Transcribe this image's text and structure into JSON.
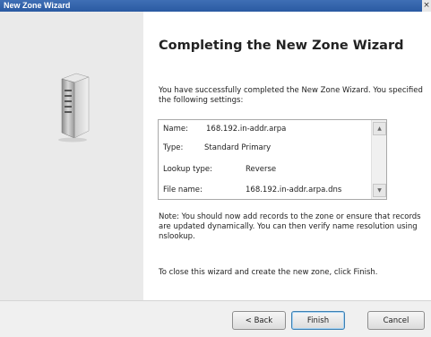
{
  "window": {
    "title": "New Zone Wizard",
    "close_glyph": "×"
  },
  "sidebar": {
    "icon": "server-icon"
  },
  "main": {
    "heading": "Completing the New Zone Wizard",
    "intro": "You have successfully completed the New Zone Wizard. You specified the following settings:",
    "settings": [
      {
        "label": "Name:",
        "value": "168.192.in-addr.arpa"
      },
      {
        "label": "Type:",
        "value": "Standard Primary"
      },
      {
        "label": "Lookup type:",
        "value": "Reverse"
      },
      {
        "label": "File name:",
        "value": "168.192.in-addr.arpa.dns"
      }
    ],
    "note": "Note: You should now add records to the zone or ensure that records are updated dynamically. You can then verify name resolution using nslookup.",
    "close_instruction": "To close this wizard and create the new zone, click Finish."
  },
  "buttons": {
    "back": "< Back",
    "finish": "Finish",
    "cancel": "Cancel"
  },
  "scrollbar": {
    "up_glyph": "▲",
    "down_glyph": "▼"
  }
}
